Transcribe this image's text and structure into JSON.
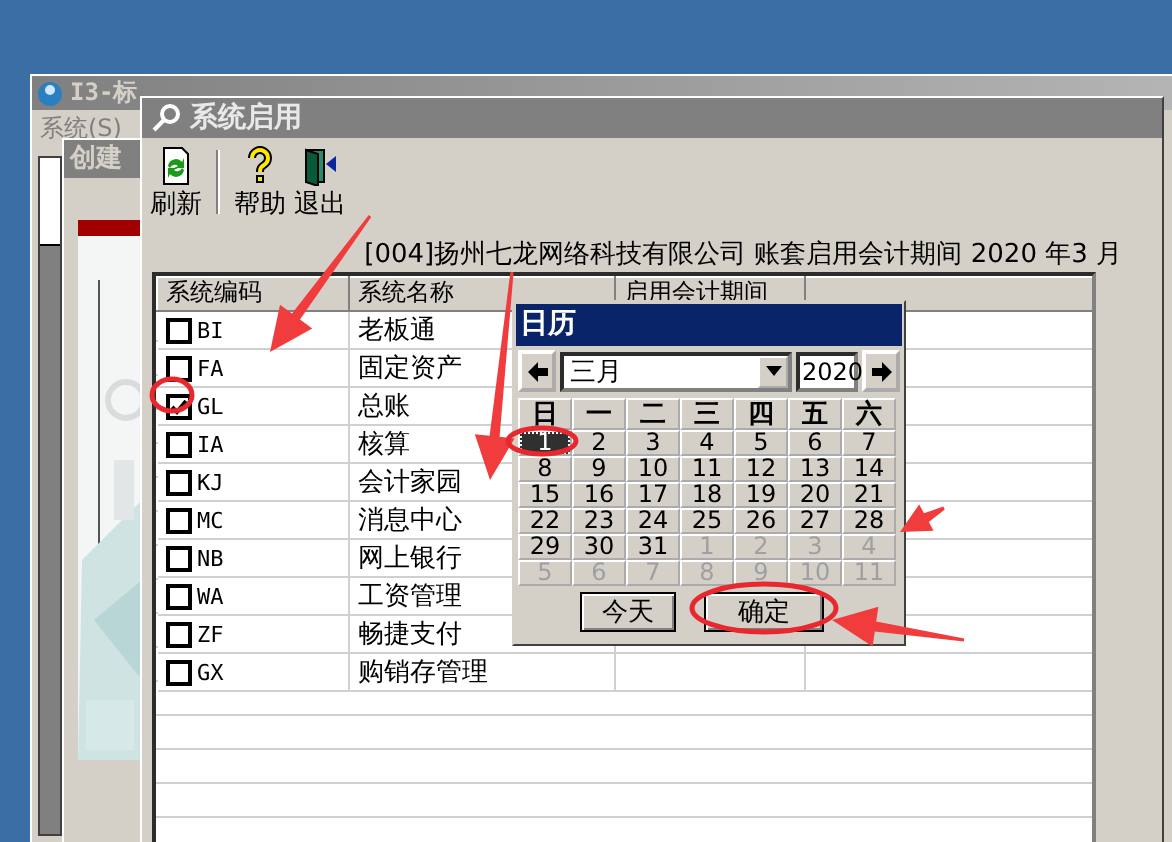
{
  "back_window": {
    "title": "I3-标",
    "menu": [
      "系统(S)"
    ]
  },
  "inner_window": {
    "title": "创建"
  },
  "window": {
    "title": "系统启用"
  },
  "toolbar": [
    {
      "label": "刷新",
      "kind": "refresh"
    },
    {
      "label": "帮助",
      "kind": "help"
    },
    {
      "label": "退出",
      "kind": "exit"
    }
  ],
  "info": "[004]扬州七龙网络科技有限公司 账套启用会计期间 2020 年3 月",
  "table": {
    "columns": [
      "系统编码",
      "系统名称",
      "启用会计期间"
    ],
    "rows": [
      {
        "code": "BI",
        "name": "老板通",
        "checked": false
      },
      {
        "code": "FA",
        "name": "固定资产",
        "checked": false
      },
      {
        "code": "GL",
        "name": "总账",
        "checked": true
      },
      {
        "code": "IA",
        "name": "核算",
        "checked": false
      },
      {
        "code": "KJ",
        "name": "会计家园",
        "checked": false
      },
      {
        "code": "MC",
        "name": "消息中心",
        "checked": false
      },
      {
        "code": "NB",
        "name": "网上银行",
        "checked": false
      },
      {
        "code": "WA",
        "name": "工资管理",
        "checked": false
      },
      {
        "code": "ZF",
        "name": "畅捷支付",
        "checked": false
      },
      {
        "code": "GX",
        "name": "购销存管理",
        "checked": false
      }
    ]
  },
  "calendar": {
    "title": "日历",
    "month": "三月",
    "year": "2020",
    "weekdays": [
      "日",
      "一",
      "二",
      "三",
      "四",
      "五",
      "六"
    ],
    "days": [
      {
        "day": "1",
        "other_month": false,
        "selected": true
      },
      {
        "day": "2",
        "other_month": false,
        "selected": false
      },
      {
        "day": "3",
        "other_month": false,
        "selected": false
      },
      {
        "day": "4",
        "other_month": false,
        "selected": false
      },
      {
        "day": "5",
        "other_month": false,
        "selected": false
      },
      {
        "day": "6",
        "other_month": false,
        "selected": false
      },
      {
        "day": "7",
        "other_month": false,
        "selected": false
      },
      {
        "day": "8",
        "other_month": false,
        "selected": false
      },
      {
        "day": "9",
        "other_month": false,
        "selected": false
      },
      {
        "day": "10",
        "other_month": false,
        "selected": false
      },
      {
        "day": "11",
        "other_month": false,
        "selected": false
      },
      {
        "day": "12",
        "other_month": false,
        "selected": false
      },
      {
        "day": "13",
        "other_month": false,
        "selected": false
      },
      {
        "day": "14",
        "other_month": false,
        "selected": false
      },
      {
        "day": "15",
        "other_month": false,
        "selected": false
      },
      {
        "day": "16",
        "other_month": false,
        "selected": false
      },
      {
        "day": "17",
        "other_month": false,
        "selected": false
      },
      {
        "day": "18",
        "other_month": false,
        "selected": false
      },
      {
        "day": "19",
        "other_month": false,
        "selected": false
      },
      {
        "day": "20",
        "other_month": false,
        "selected": false
      },
      {
        "day": "21",
        "other_month": false,
        "selected": false
      },
      {
        "day": "22",
        "other_month": false,
        "selected": false
      },
      {
        "day": "23",
        "other_month": false,
        "selected": false
      },
      {
        "day": "24",
        "other_month": false,
        "selected": false
      },
      {
        "day": "25",
        "other_month": false,
        "selected": false
      },
      {
        "day": "26",
        "other_month": false,
        "selected": false
      },
      {
        "day": "27",
        "other_month": false,
        "selected": false
      },
      {
        "day": "28",
        "other_month": false,
        "selected": false
      },
      {
        "day": "29",
        "other_month": false,
        "selected": false
      },
      {
        "day": "30",
        "other_month": false,
        "selected": false
      },
      {
        "day": "31",
        "other_month": false,
        "selected": false
      },
      {
        "day": "1",
        "other_month": true,
        "selected": false
      },
      {
        "day": "2",
        "other_month": true,
        "selected": false
      },
      {
        "day": "3",
        "other_month": true,
        "selected": false
      },
      {
        "day": "4",
        "other_month": true,
        "selected": false
      },
      {
        "day": "5",
        "other_month": true,
        "selected": false
      },
      {
        "day": "6",
        "other_month": true,
        "selected": false
      },
      {
        "day": "7",
        "other_month": true,
        "selected": false
      },
      {
        "day": "8",
        "other_month": true,
        "selected": false
      },
      {
        "day": "9",
        "other_month": true,
        "selected": false
      },
      {
        "day": "10",
        "other_month": true,
        "selected": false
      },
      {
        "day": "11",
        "other_month": true,
        "selected": false
      }
    ],
    "buttons": [
      "今天",
      "确定"
    ]
  },
  "annotations": [
    {
      "kind": "arrow"
    },
    {
      "kind": "arrow"
    },
    {
      "kind": "arrow"
    },
    {
      "kind": "arrow"
    },
    {
      "kind": "ellipse"
    },
    {
      "kind": "ellipse"
    },
    {
      "kind": "ellipse"
    }
  ]
}
